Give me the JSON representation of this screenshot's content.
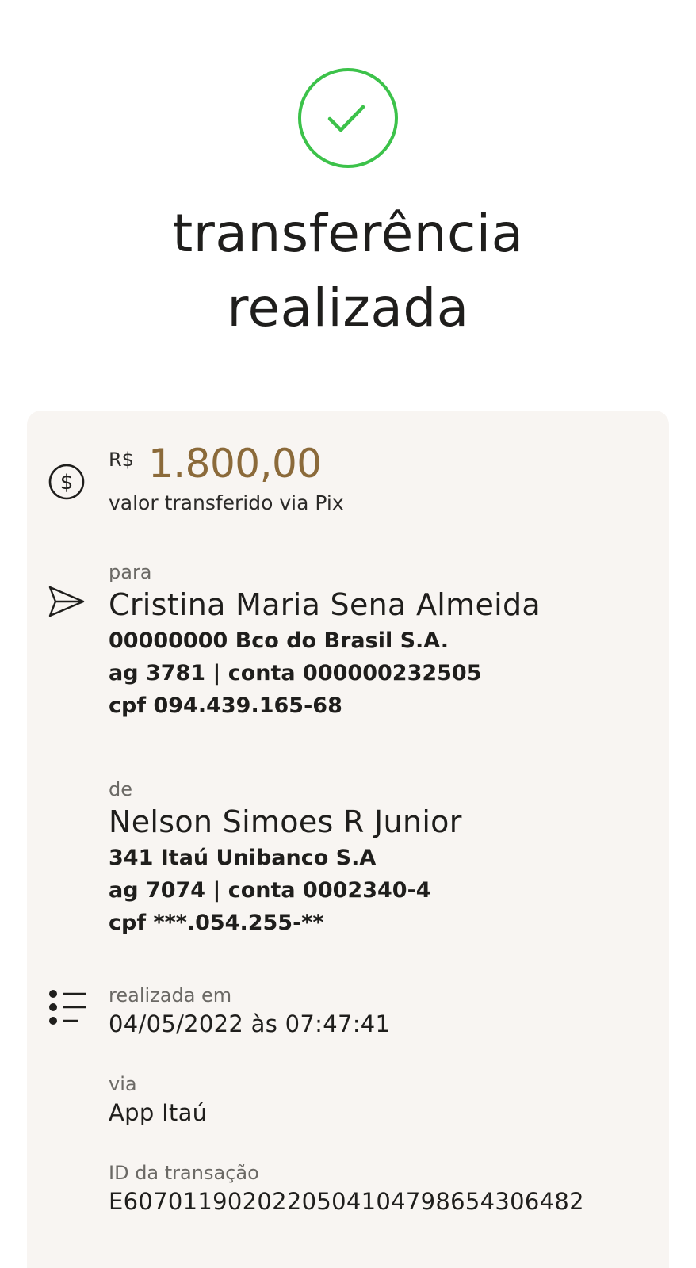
{
  "status": {
    "icon": "check-circle-icon",
    "title_line1": "transferência",
    "title_line2": "realizada",
    "icon_color": "#3cc24a"
  },
  "amount": {
    "currency": "R$",
    "value": "1.800,00",
    "caption": "valor transferido via Pix",
    "icon": "dollar-circle-icon",
    "value_color": "#8b6a3a"
  },
  "recipient": {
    "icon": "send-icon",
    "label": "para",
    "name": "Cristina Maria Sena Almeida",
    "bank": "00000000 Bco do Brasil S.A.",
    "account": "ag 3781 | conta 000000232505",
    "cpf": "cpf 094.439.165-68"
  },
  "sender": {
    "label": "de",
    "name": "Nelson Simoes R Junior",
    "bank": "341 Itaú Unibanco S.A",
    "account": "ag 7074 | conta 0002340-4",
    "cpf": "cpf ***.054.255-**"
  },
  "details": {
    "icon": "list-icon",
    "date_label": "realizada em",
    "date_value": "04/05/2022 às 07:47:41",
    "via_label": "via",
    "via_value": "App Itaú",
    "id_label": "ID da transação",
    "id_value": "E60701190202205041047986543064​82"
  },
  "colors": {
    "card_background": "#f8f5f2",
    "page_background": "#ffffff"
  }
}
